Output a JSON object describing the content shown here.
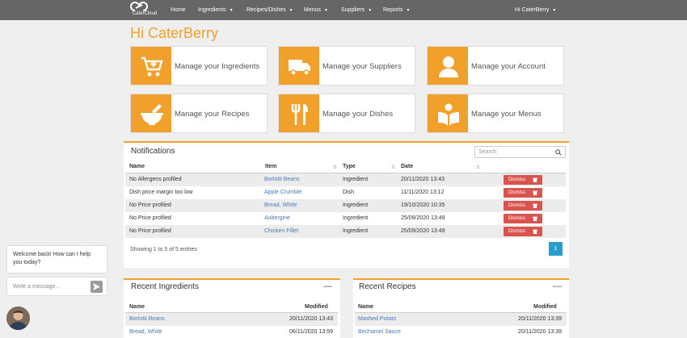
{
  "brand": {
    "name": "CaterCloud"
  },
  "nav": {
    "items": [
      {
        "label": "Home",
        "caret": false
      },
      {
        "label": "Ingredients",
        "caret": true
      },
      {
        "label": "Recipes/Dishes",
        "caret": true
      },
      {
        "label": "Menus",
        "caret": true
      },
      {
        "label": "Suppliers",
        "caret": true
      },
      {
        "label": "Reports",
        "caret": true
      }
    ],
    "user": "Hi CaterBerry"
  },
  "greeting": "Hi CaterBerry",
  "tiles": [
    {
      "label": "Manage your Ingredients",
      "icon": "cart-plus-icon"
    },
    {
      "label": "Manage your Suppliers",
      "icon": "truck-icon"
    },
    {
      "label": "Manage your Account",
      "icon": "user-icon"
    },
    {
      "label": "Manage your Recipes",
      "icon": "mortar-pestle-icon"
    },
    {
      "label": "Manage your Dishes",
      "icon": "utensils-icon"
    },
    {
      "label": "Manage your Menus",
      "icon": "book-reader-icon"
    }
  ],
  "notifications": {
    "title": "Notifications",
    "search_placeholder": "Search",
    "columns": {
      "name": "Name",
      "item": "Item",
      "type": "Type",
      "date": "Date"
    },
    "rows": [
      {
        "name": "No Allergens profiled",
        "item": "Borlotti Beans",
        "type": "Ingredient",
        "date": "20/11/2020 13:43"
      },
      {
        "name": "Dish price margin too low",
        "item": "Apple Crumble",
        "type": "Dish",
        "date": "11/11/2020 13:12"
      },
      {
        "name": "No Price profiled",
        "item": "Bread, White",
        "type": "Ingredient",
        "date": "19/10/2020 10:35"
      },
      {
        "name": "No Price profiled",
        "item": "Aubergine",
        "type": "Ingredient",
        "date": "25/09/2020 13:49"
      },
      {
        "name": "No Price profiled",
        "item": "Chicken Fillet",
        "type": "Ingredient",
        "date": "25/09/2020 13:49"
      }
    ],
    "dismiss_label": "Dismiss",
    "info": "Showing 1 to 5 of 5 entries",
    "page": "1"
  },
  "recent_ingredients": {
    "title": "Recent Ingredients",
    "columns": {
      "name": "Name",
      "modified": "Modified"
    },
    "rows": [
      {
        "name": "Borlotti Beans",
        "modified": "20/11/2020 13:43"
      },
      {
        "name": "Bread, White",
        "modified": "06/11/2020 13:59"
      }
    ]
  },
  "recent_recipes": {
    "title": "Recent Recipes",
    "columns": {
      "name": "Name",
      "modified": "Modified"
    },
    "rows": [
      {
        "name": "Mashed Potato",
        "modified": "20/11/2020 13:39"
      },
      {
        "name": "Bechamel Sauce",
        "modified": "20/11/2020 13:39"
      }
    ]
  },
  "chat": {
    "message": "Welcome back! How can I help you today?",
    "input_placeholder": "Write a message..."
  },
  "colors": {
    "accent": "#f0a02b",
    "nav": "#666666",
    "danger": "#d9534f",
    "page": "#2b9dcc",
    "link": "#4a7ab5"
  }
}
